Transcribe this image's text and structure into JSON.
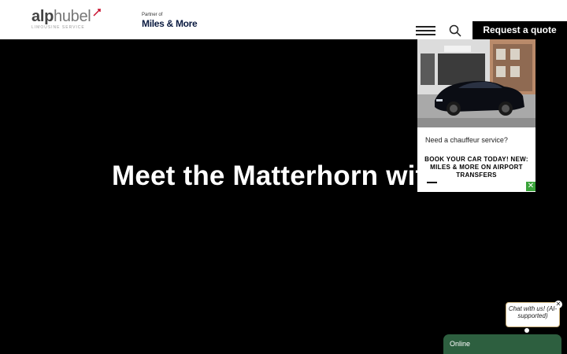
{
  "header": {
    "logo_main": "alp",
    "logo_second": "hubel",
    "logo_sub": "LIMOUSINE SERVICE",
    "partner_of": "Partner of",
    "partner_name": "Miles & More",
    "menu_icon": "hamburger-menu-icon",
    "search_icon": "search-icon",
    "quote_button": "Request a quote"
  },
  "hero": {
    "title": "Meet the Matterhorn with"
  },
  "promo": {
    "image_alt": "photo",
    "question": "Need a chauffeur service?",
    "headline": "BOOK YOUR CAR TODAY! NEW: MILES & MORE ON AIRPORT TRANSFERS",
    "close_icon": "close-icon"
  },
  "chat": {
    "bubble_text": "Chat with us! (AI-supported)",
    "close_icon": "close-icon",
    "status": "Online"
  },
  "colors": {
    "accent_red": "#c8102e",
    "chat_green": "#2d5f3f",
    "close_green": "#3aa33a",
    "brand_navy": "#0a1a40"
  }
}
